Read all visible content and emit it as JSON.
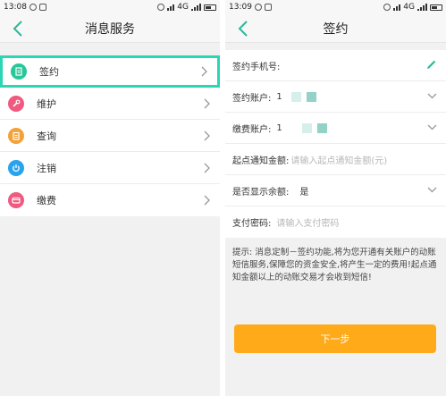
{
  "left_screen": {
    "status": {
      "time": "13:08",
      "network": "4G"
    },
    "title": "消息服务",
    "items": [
      {
        "label": "签约",
        "icon": "document-icon",
        "color": "#28c79a"
      },
      {
        "label": "维护",
        "icon": "wrench-icon",
        "color": "#ef5a7e"
      },
      {
        "label": "查询",
        "icon": "clipboard-icon",
        "color": "#f3a23b"
      },
      {
        "label": "注销",
        "icon": "power-icon",
        "color": "#2aa3ee"
      },
      {
        "label": "缴费",
        "icon": "card-icon",
        "color": "#ef5a7e"
      }
    ],
    "highlight_color": "#2ad6b4"
  },
  "right_screen": {
    "status": {
      "time": "13:09",
      "network": "4G"
    },
    "title": "签约",
    "form": {
      "phone_label": "签约手机号:",
      "account_label": "签约账户:",
      "account_value": "1",
      "fee_account_label": "缴费账户:",
      "fee_account_value": "1",
      "threshold_label": "起点通知金额:",
      "threshold_placeholder": "请输入起点通知金额(元)",
      "show_balance_label": "是否显示余额:",
      "show_balance_value": "是",
      "password_label": "支付密码:",
      "password_placeholder": "请输入支付密码"
    },
    "hint": "提示: 消息定制－签约功能,将为您开通有关账户的动账短信服务,保障您的资金安全,将产生一定的费用!起点通知金额以上的动账交易才会收到短信!",
    "next_label": "下一步",
    "accent": "#ffaa18",
    "teal": "#2ab89a"
  }
}
